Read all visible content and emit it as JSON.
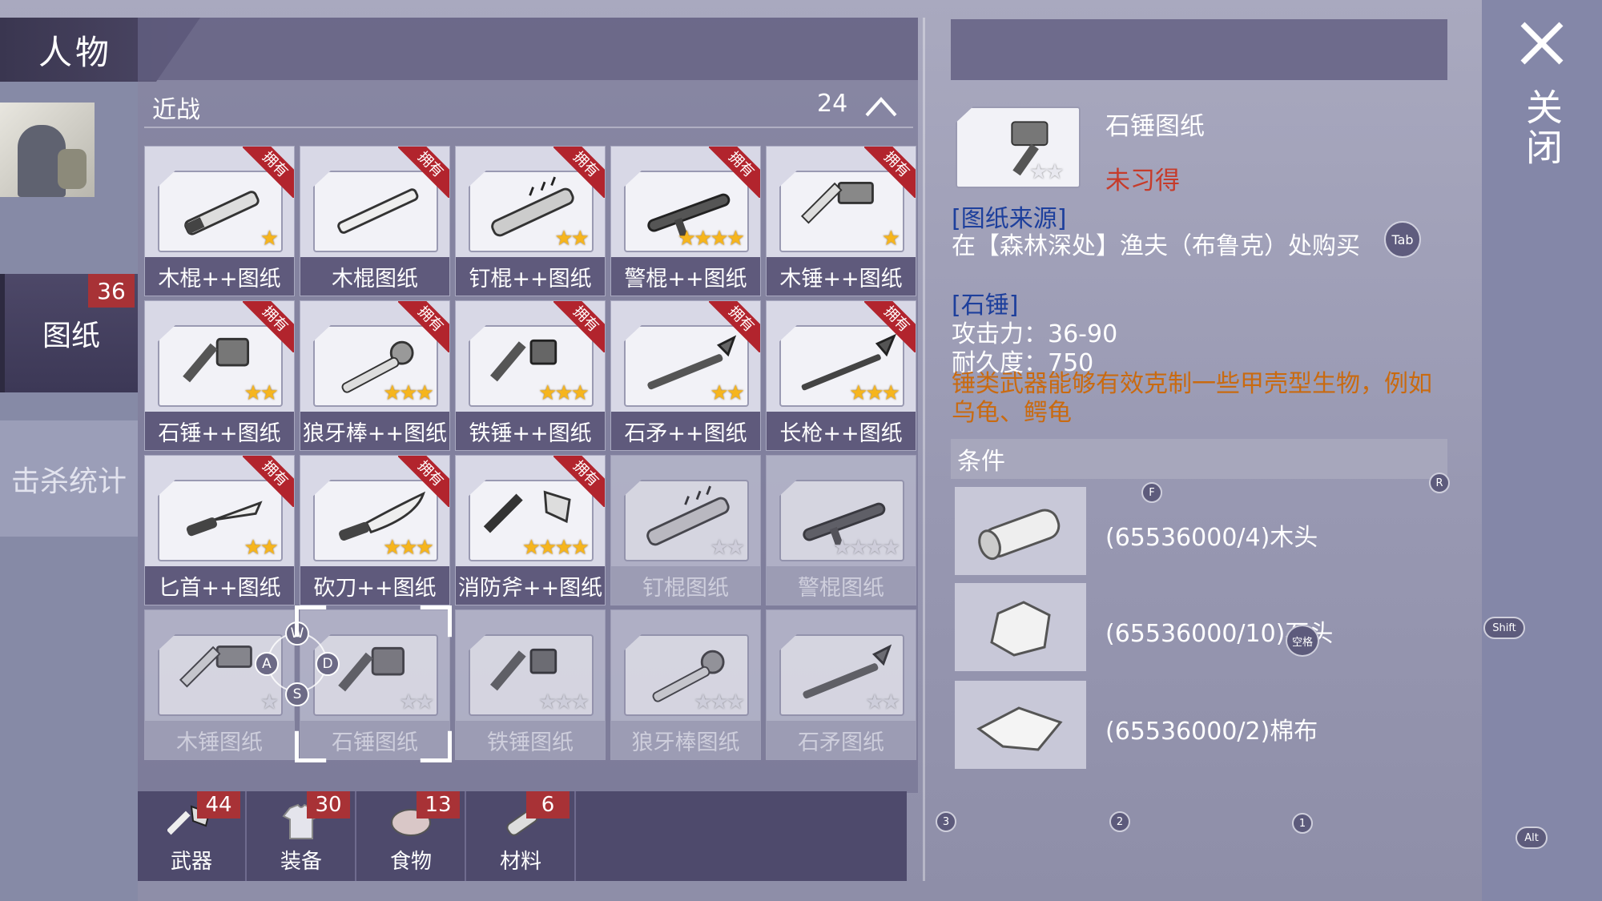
{
  "title": "人物",
  "sidebar": {
    "blueprint_label": "图纸",
    "blueprint_badge": "36",
    "kills_label": "击杀统计"
  },
  "category": {
    "label": "近战",
    "count": "24"
  },
  "owned_tag": "拥有",
  "cards": [
    {
      "name": "木棍++图纸",
      "stars": 1,
      "max": 1,
      "owned": true,
      "icon": "club-icon"
    },
    {
      "name": "木棍图纸",
      "stars": 0,
      "max": 0,
      "owned": true,
      "icon": "stick-icon"
    },
    {
      "name": "钉棍++图纸",
      "stars": 2,
      "max": 2,
      "owned": true,
      "icon": "nail-club-icon"
    },
    {
      "name": "警棍++图纸",
      "stars": 4,
      "max": 4,
      "owned": true,
      "icon": "baton-icon"
    },
    {
      "name": "木锤++图纸",
      "stars": 1,
      "max": 1,
      "owned": true,
      "icon": "hammer-icon"
    },
    {
      "name": "石锤++图纸",
      "stars": 2,
      "max": 2,
      "owned": true,
      "icon": "stone-hammer-icon"
    },
    {
      "name": "狼牙棒++图纸",
      "stars": 3,
      "max": 3,
      "owned": true,
      "icon": "mace-icon"
    },
    {
      "name": "铁锤++图纸",
      "stars": 3,
      "max": 3,
      "owned": true,
      "icon": "iron-hammer-icon"
    },
    {
      "name": "石矛++图纸",
      "stars": 2,
      "max": 2,
      "owned": true,
      "icon": "stone-spear-icon"
    },
    {
      "name": "长枪++图纸",
      "stars": 3,
      "max": 3,
      "owned": true,
      "icon": "long-spear-icon"
    },
    {
      "name": "匕首++图纸",
      "stars": 2,
      "max": 2,
      "owned": true,
      "icon": "dagger-icon"
    },
    {
      "name": "砍刀++图纸",
      "stars": 3,
      "max": 3,
      "owned": true,
      "icon": "machete-icon"
    },
    {
      "name": "消防斧++图纸",
      "stars": 4,
      "max": 4,
      "owned": true,
      "icon": "fire-axe-icon"
    },
    {
      "name": "钉棍图纸",
      "stars": 0,
      "max": 2,
      "owned": false,
      "icon": "nail-club-icon"
    },
    {
      "name": "警棍图纸",
      "stars": 0,
      "max": 4,
      "owned": false,
      "icon": "baton-icon"
    },
    {
      "name": "木锤图纸",
      "stars": 0,
      "max": 1,
      "owned": false,
      "icon": "hammer-icon"
    },
    {
      "name": "石锤图纸",
      "stars": 0,
      "max": 2,
      "owned": false,
      "icon": "stone-hammer-icon"
    },
    {
      "name": "铁锤图纸",
      "stars": 0,
      "max": 3,
      "owned": false,
      "icon": "iron-hammer-icon"
    },
    {
      "name": "狼牙棒图纸",
      "stars": 0,
      "max": 3,
      "owned": false,
      "icon": "mace-icon"
    },
    {
      "name": "石矛图纸",
      "stars": 0,
      "max": 2,
      "owned": false,
      "icon": "stone-spear-icon"
    }
  ],
  "pad_keys": {
    "up": "W",
    "left": "A",
    "right": "D",
    "down": "S"
  },
  "bottom_tabs": [
    {
      "label": "武器",
      "badge": "44",
      "icon": "axe-icon"
    },
    {
      "label": "装备",
      "badge": "30",
      "icon": "shirt-icon"
    },
    {
      "label": "食物",
      "badge": "13",
      "icon": "meat-icon"
    },
    {
      "label": "材料",
      "badge": "6",
      "icon": "log-icon"
    }
  ],
  "detail": {
    "name": "石锤图纸",
    "stars": 0,
    "max": 2,
    "status": "未习得",
    "source_title": "[图纸来源]",
    "source_text": "在【森林深处】渔夫（布鲁克）处购买",
    "tab_hint": "Tab",
    "stat_title": "[石锤]",
    "attack": "攻击力：36-90",
    "durability": "耐久度：750",
    "description": "锤类武器能够有效克制一些甲壳型生物，例如乌龟、鳄龟",
    "conditions_label": "条件",
    "conditions": [
      {
        "text": "(65536000/4)木头",
        "icon": "wood-icon"
      },
      {
        "text": "(65536000/10)石头",
        "icon": "stone-icon"
      },
      {
        "text": "(65536000/2)棉布",
        "icon": "cloth-icon"
      }
    ]
  },
  "close_label": "关闭",
  "key_hints": {
    "f": "F",
    "r": "R",
    "shift": "Shift",
    "space": "空格",
    "three": "3",
    "two": "2",
    "one": "1",
    "alt": "Alt"
  },
  "colors": {
    "accent_red": "#a83236",
    "status_red": "#c63b2a",
    "link_blue": "#1d3f9c",
    "desc_orange": "#c96a10",
    "star_gold": "#f6b51d"
  }
}
